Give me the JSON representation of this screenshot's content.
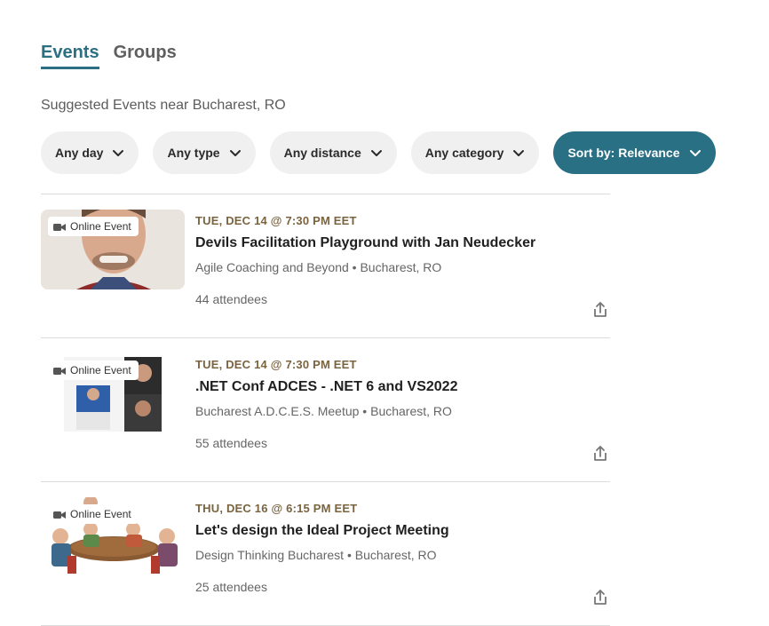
{
  "tabs": [
    {
      "label": "Events",
      "active": true
    },
    {
      "label": "Groups",
      "active": false
    }
  ],
  "subtitle": "Suggested Events near Bucharest, RO",
  "filters": [
    {
      "label": "Any day"
    },
    {
      "label": "Any type"
    },
    {
      "label": "Any distance"
    },
    {
      "label": "Any category"
    },
    {
      "label": "Sort by: Relevance"
    }
  ],
  "colors": {
    "accent": "#2b6f83",
    "date": "#7a6440",
    "divider": "#dcdcdc"
  },
  "events": [
    {
      "badge": "Online Event",
      "date": "TUE, DEC 14 @ 7:30 PM EET",
      "title": "Devils Facilitation Playground with Jan Neudecker",
      "group": "Agile Coaching and Beyond • Bucharest, RO",
      "attendees": "44 attendees"
    },
    {
      "badge": "Online Event",
      "date": "TUE, DEC 14 @ 7:30 PM EET",
      "title": ".NET Conf ADCES - .NET 6 and VS2022",
      "group": "Bucharest A.D.C.E.S. Meetup • Bucharest, RO",
      "attendees": "55 attendees"
    },
    {
      "badge": "Online Event",
      "date": "THU, DEC 16 @ 6:15 PM EET",
      "title": "Let's design the Ideal Project Meeting",
      "group": "Design Thinking Bucharest • Bucharest, RO",
      "attendees": "25 attendees"
    }
  ]
}
